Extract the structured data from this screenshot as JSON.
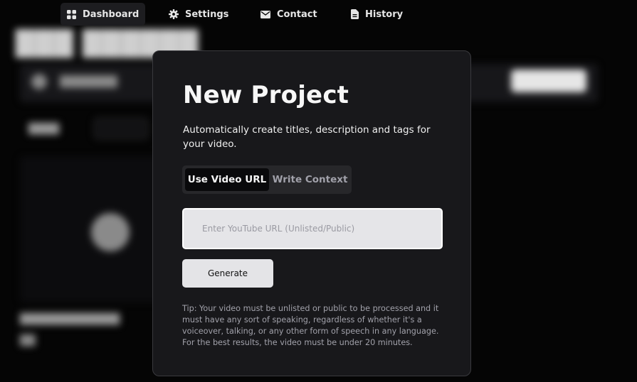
{
  "nav": {
    "items": [
      {
        "label": "Dashboard",
        "icon": "grid-icon",
        "active": true
      },
      {
        "label": "Settings",
        "icon": "gear-icon",
        "active": false
      },
      {
        "label": "Contact",
        "icon": "mail-icon",
        "active": false
      },
      {
        "label": "History",
        "icon": "document-icon",
        "active": false
      }
    ]
  },
  "modal": {
    "title": "New Project",
    "description": "Automatically create titles, description and tags for your video.",
    "tabs": [
      {
        "label": "Use Video URL",
        "active": true
      },
      {
        "label": "Write Context",
        "active": false
      }
    ],
    "url_input": {
      "value": "",
      "placeholder": "Enter YouTube URL (Unlisted/Public)"
    },
    "generate_label": "Generate",
    "tip": "Tip: Your video must be unlisted or public to be processed and it must have any sort of speaking, regardless of whether it's a voiceover, talking, or any other form of speech in any language. For the best results, the video must be under 20 minutes."
  },
  "colors": {
    "page_background": "#050505",
    "modal_background": "#18181b",
    "input_background": "#e5e5e8",
    "button_background": "#e4e4e7",
    "muted_text": "#a1a1aa"
  }
}
